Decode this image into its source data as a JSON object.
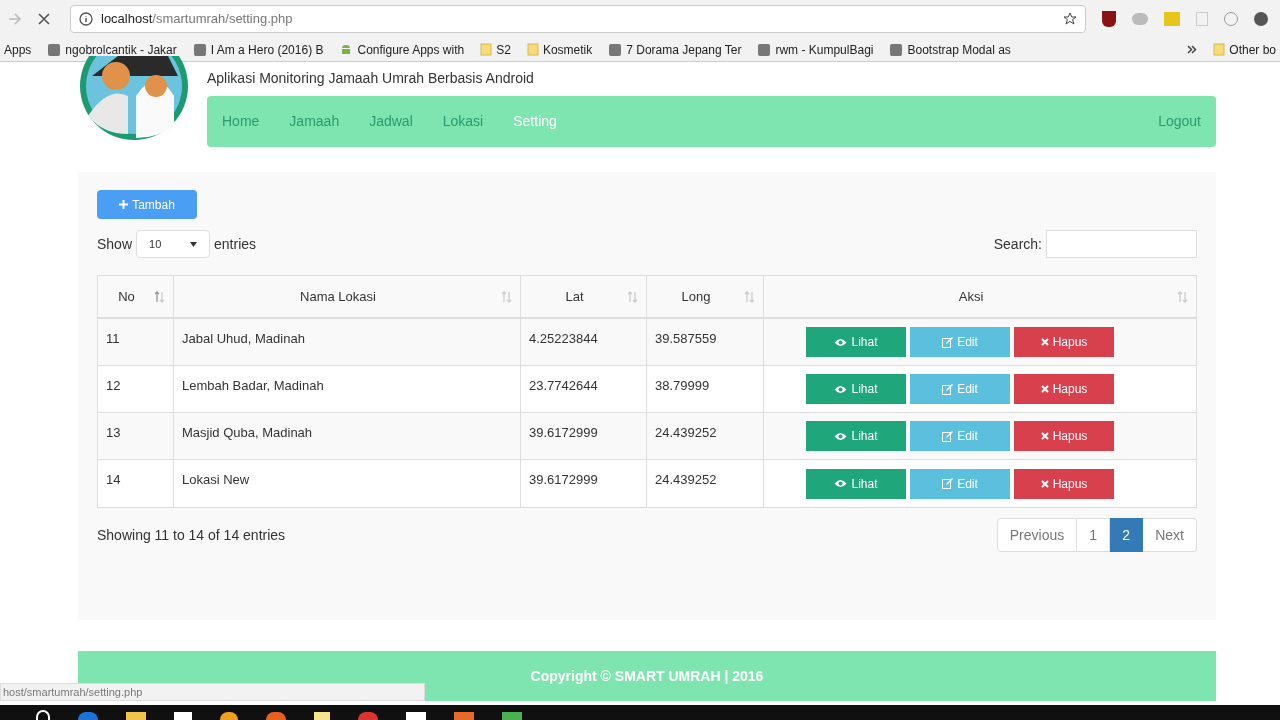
{
  "browser": {
    "url_host": "localhost",
    "url_path": "/smartumrah/setting.php",
    "apps_label": "Apps",
    "bookmarks": [
      {
        "label": "ngobrolcantik - Jakar",
        "kind": "site"
      },
      {
        "label": "I Am a Hero (2016) B",
        "kind": "site"
      },
      {
        "label": "Configure Apps with",
        "kind": "android"
      },
      {
        "label": "S2",
        "kind": "folder"
      },
      {
        "label": "Kosmetik",
        "kind": "folder"
      },
      {
        "label": "7 Dorama Jepang Ter",
        "kind": "site"
      },
      {
        "label": "rwm - KumpulBagi",
        "kind": "site"
      },
      {
        "label": "Bootstrap Modal as",
        "kind": "site"
      }
    ],
    "other_bookmarks": "Other bo"
  },
  "header": {
    "subtitle": "Aplikasi Monitoring Jamaah Umrah Berbasis Android"
  },
  "nav": {
    "items": [
      {
        "label": "Home",
        "selected": false
      },
      {
        "label": "Jamaah",
        "selected": false
      },
      {
        "label": "Jadwal",
        "selected": false
      },
      {
        "label": "Lokasi",
        "selected": false
      },
      {
        "label": "Setting",
        "selected": true
      }
    ],
    "logout": "Logout"
  },
  "add_button": "Tambah",
  "length": {
    "show": "Show",
    "value": "10",
    "entries": "entries"
  },
  "search": {
    "label": "Search:"
  },
  "table": {
    "columns": [
      "No",
      "Nama Lokasi",
      "Lat",
      "Long",
      "Aksi"
    ],
    "rows": [
      {
        "no": "11",
        "name": "Jabal Uhud, Madinah",
        "lat": "4.25223844",
        "long": "39.587559",
        "actions": {
          "view": "Lihat",
          "edit": "Edit",
          "delete": "Hapus"
        }
      },
      {
        "no": "12",
        "name": "Lembah Badar, Madinah",
        "lat": "23.7742644",
        "long": "38.79999",
        "actions": {
          "view": "Lihat",
          "edit": "Edit",
          "delete": "Hapus"
        }
      },
      {
        "no": "13",
        "name": "Masjid Quba, Madinah",
        "lat": "39.6172999",
        "long": "24.439252",
        "actions": {
          "view": "Lihat",
          "edit": "Edit",
          "delete": "Hapus"
        }
      },
      {
        "no": "14",
        "name": "Lokasi New",
        "lat": "39.6172999",
        "long": "24.439252",
        "actions": {
          "view": "Lihat",
          "edit": "Edit",
          "delete": "Hapus"
        }
      }
    ]
  },
  "info": "Showing 11 to 14 of 14 entries",
  "pagination": {
    "previous": "Previous",
    "pages": [
      {
        "label": "1",
        "selected": false
      },
      {
        "label": "2",
        "selected": true
      }
    ],
    "next": "Next"
  },
  "footer": "Copyright © SMART UMRAH | 2016",
  "status_url": "host/smartumrah/setting.php"
}
